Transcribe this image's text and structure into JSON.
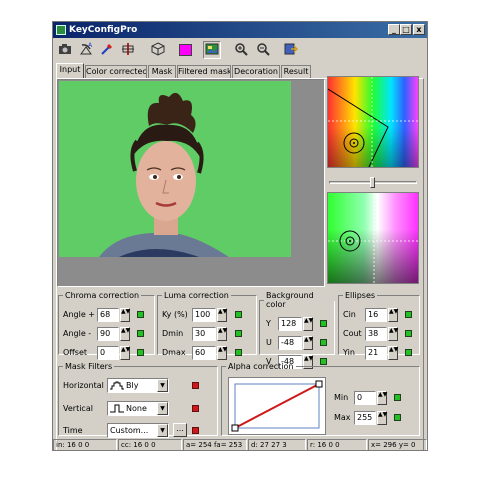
{
  "window": {
    "title": "KeyConfigPro",
    "min_label": "_",
    "max_label": "□",
    "close_label": "x"
  },
  "toolbar": {
    "icons": [
      "camera-icon",
      "satellite-dish-icon",
      "eyedropper-icon",
      "plus-split-icon",
      "cube-icon",
      "magenta-color-swatch",
      "image-icon",
      "zoom-in-icon",
      "zoom-out-icon",
      "export-icon"
    ],
    "swatch_color": "#ff00ff"
  },
  "tabs": [
    "Input",
    "Color correctec",
    "Mask",
    "Filtered mask",
    "Decoration",
    "Result"
  ],
  "active_tab": "Input",
  "chroma": {
    "title": "Chroma correction",
    "rows": [
      {
        "label": "Angle +",
        "value": "68"
      },
      {
        "label": "Angle -",
        "value": "90"
      },
      {
        "label": "Offset",
        "value": "0"
      }
    ]
  },
  "luma": {
    "title": "Luma correction",
    "rows": [
      {
        "label": "Ky (%)",
        "value": "100"
      },
      {
        "label": "Dmin",
        "value": "30"
      },
      {
        "label": "Dmax",
        "value": "60"
      }
    ]
  },
  "background": {
    "title": "Background color",
    "rows": [
      {
        "label": "Y",
        "value": "128"
      },
      {
        "label": "U",
        "value": "-48"
      },
      {
        "label": "V",
        "value": "-48"
      }
    ]
  },
  "ellipses": {
    "title": "Ellipses",
    "rows": [
      {
        "label": "Cin",
        "value": "16"
      },
      {
        "label": "Cout",
        "value": "38"
      },
      {
        "label": "Yin",
        "value": "21"
      }
    ]
  },
  "mask_filters": {
    "title": "Mask Filters",
    "horizontal_label": "Horizontal",
    "horizontal_value": "Bly",
    "vertical_label": "Vertical",
    "vertical_value": "None",
    "time_label": "Time",
    "time_value": "Custom...",
    "browse_label": "..."
  },
  "alpha": {
    "title": "Alpha correction",
    "min_label": "Min",
    "min_value": "0",
    "max_label": "Max",
    "max_value": "255"
  },
  "status": {
    "in": "in: 16  0  0",
    "cc": "cc: 16  0  0",
    "a": "a= 254 fa= 253",
    "d": "d: 27  27  3",
    "r": "r: 16  0  0",
    "xy": "x= 296 y= 0"
  }
}
